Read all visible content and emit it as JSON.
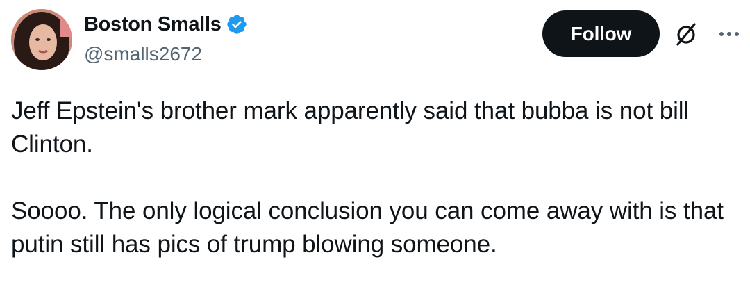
{
  "author": {
    "display_name": "Boston Smalls",
    "handle": "@smalls2672",
    "verified": true,
    "verified_color": "#1d9bf0"
  },
  "actions": {
    "follow_label": "Follow",
    "grok_icon": "grok-slash-icon",
    "more_icon": "more-horizontal-icon"
  },
  "tweet": {
    "paragraphs": [
      "Jeff Epstein's brother mark apparently said that bubba is not bill Clinton.",
      "Soooo. The only logical conclusion you can come away with is that putin still has pics of trump blowing someone."
    ]
  },
  "colors": {
    "text": "#0f1419",
    "secondary": "#536471",
    "button_bg": "#0f1419",
    "button_text": "#ffffff"
  }
}
